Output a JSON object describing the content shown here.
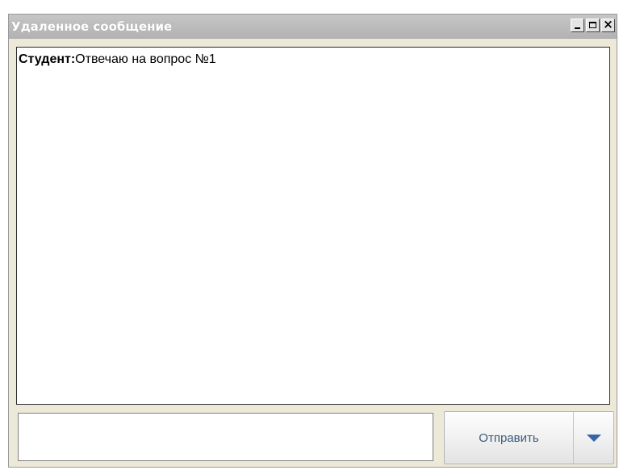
{
  "window": {
    "title": "Удаленное сообщение",
    "controls": [
      "minimize-icon",
      "maximize-icon",
      "close-icon"
    ],
    "close_glyph": "×"
  },
  "chat": {
    "messages": [
      {
        "author": "Студент:",
        "text": "Отвечаю на вопрос №1"
      }
    ]
  },
  "composer": {
    "input_value": "",
    "send_label": "Отправить",
    "dropdown_icon": "chevron-down-icon"
  },
  "colors": {
    "titlebar": "#bdbdbd",
    "window_bg": "#ece9d8",
    "send_text": "#3b5a7a",
    "chevron": "#3566a8"
  }
}
